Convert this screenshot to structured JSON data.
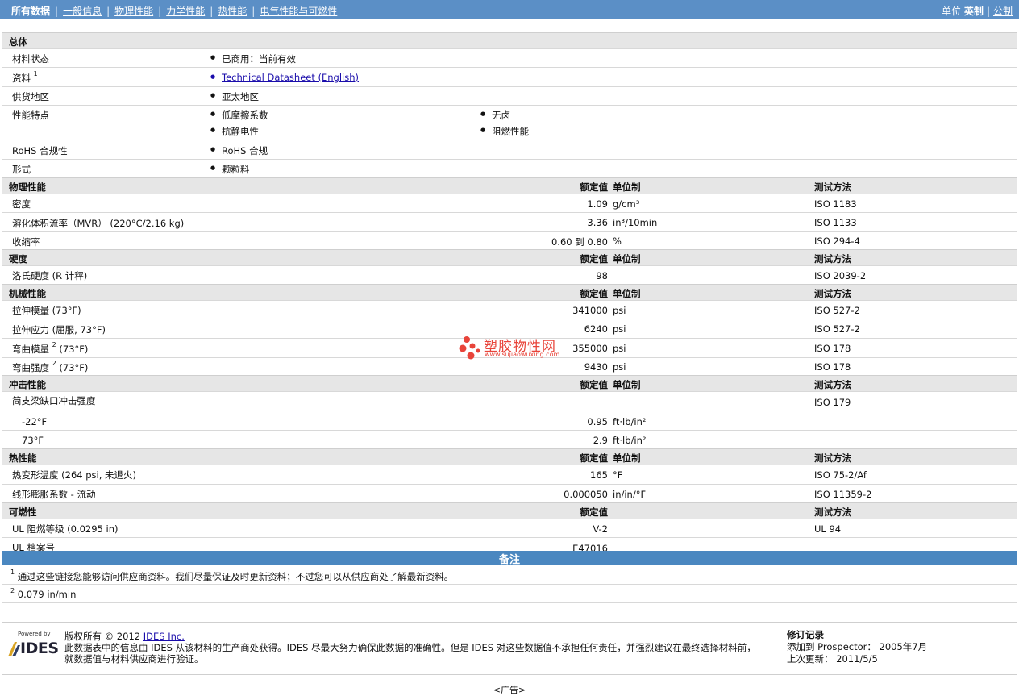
{
  "topnav": {
    "items": [
      {
        "label": "所有数据",
        "current": true
      },
      {
        "label": "一般信息"
      },
      {
        "label": "物理性能"
      },
      {
        "label": "力学性能"
      },
      {
        "label": "热性能"
      },
      {
        "label": "电气性能与可燃性"
      }
    ],
    "units_label": "单位",
    "unit_english": "英制",
    "unit_metric": "公制"
  },
  "general": {
    "title": "总体",
    "material_status_label": "材料状态",
    "material_status": "已商用：当前有效",
    "documents_label": "资料",
    "documents_sup": "1",
    "documents_link": "Technical Datasheet (English)",
    "region_label": "供货地区",
    "region": "亚太地区",
    "features_label": "性能特点",
    "features": [
      "低摩擦系数",
      "无卤",
      "抗静电性",
      "阻燃性能"
    ],
    "rohs_label": "RoHS 合规性",
    "rohs": "RoHS 合规",
    "form_label": "形式",
    "form": "颗粒料"
  },
  "headers": {
    "nominal": "额定值",
    "unit": "单位制",
    "test": "测试方法"
  },
  "physical": {
    "title": "物理性能",
    "rows": [
      {
        "name": "密度",
        "value": "1.09",
        "unit": "g/cm³",
        "test": "ISO 1183"
      },
      {
        "name": "溶化体积流率（MVR） (220°C/2.16 kg)",
        "value": "3.36",
        "unit": "in³/10min",
        "test": "ISO 1133"
      },
      {
        "name": "收缩率",
        "value": "0.60 到  0.80",
        "unit": "%",
        "test": "ISO 294-4"
      }
    ]
  },
  "hardness": {
    "title": "硬度",
    "rows": [
      {
        "name": "洛氏硬度 (R 计秤)",
        "value": "98",
        "unit": "",
        "test": "ISO 2039-2"
      }
    ]
  },
  "mechanical": {
    "title": "机械性能",
    "rows": [
      {
        "name": "拉伸模量 (73°F)",
        "sup": "",
        "value": "341000",
        "unit": "psi",
        "test": "ISO 527-2"
      },
      {
        "name": "拉伸应力 (屈服, 73°F)",
        "sup": "",
        "value": "6240",
        "unit": "psi",
        "test": "ISO 527-2"
      },
      {
        "name": "弯曲模量",
        "sup": "2",
        "tail": " (73°F)",
        "value": "355000",
        "unit": "psi",
        "test": "ISO 178"
      },
      {
        "name": "弯曲强度",
        "sup": "2",
        "tail": " (73°F)",
        "value": "9430",
        "unit": "psi",
        "test": "ISO 178"
      }
    ]
  },
  "impact": {
    "title": "冲击性能",
    "rows": [
      {
        "name": "简支梁缺口冲击强度",
        "value": "",
        "unit": "",
        "test": "ISO 179"
      },
      {
        "name": "-22°F",
        "value": "0.95",
        "unit": "ft·lb/in²",
        "test": ""
      },
      {
        "name": "73°F",
        "value": "2.9",
        "unit": "ft·lb/in²",
        "test": ""
      }
    ]
  },
  "thermal": {
    "title": "热性能",
    "rows": [
      {
        "name": "热变形温度 (264 psi, 未退火)",
        "value": "165",
        "unit": "°F",
        "test": "ISO 75-2/Af"
      },
      {
        "name": "线形膨胀系数 - 流动",
        "value": "0.000050",
        "unit": "in/in/°F",
        "test": "ISO 11359-2"
      }
    ]
  },
  "flammability": {
    "title": "可燃性",
    "rows": [
      {
        "name": "UL 阻燃等级 (0.0295 in)",
        "value": "V-2",
        "unit": "",
        "test": "UL 94"
      },
      {
        "name": "UL 档案号",
        "value": "E47016",
        "unit": "",
        "test": ""
      }
    ]
  },
  "notes": {
    "title": "备注",
    "items": [
      {
        "sup": "1",
        "text": "通过这些链接您能够访问供应商资料。我们尽量保证及时更新资料；不过您可以从供应商处了解最新资料。"
      },
      {
        "sup": "2",
        "text": "0.079 in/min"
      }
    ]
  },
  "footer": {
    "logo_powered": "Powered by",
    "logo_name": "IDES",
    "copyright_prefix": "版权所有  © 2012 ",
    "copyright_link": "IDES Inc.",
    "disclaimer_1": "此数据表中的信息由 IDES 从该材料的生产商处获得。IDES 尽最大努力确保此数据的准确性。但是 IDES 对这些数据值不承担任何责任，并强烈建议在最终选择材料前，",
    "disclaimer_2": "就数据值与材料供应商进行验证。",
    "rev_title": "修订记录",
    "added_label": "添加到 Prospector：",
    "added_value": "2005年7月",
    "updated_label": "上次更新：",
    "updated_value": "2011/5/5"
  },
  "ad_label": "<广告>",
  "watermark": {
    "title": "塑胶物性网",
    "url": "www.sujiaowuxing.com"
  },
  "colors": {
    "topbar": "#5b8fc6",
    "section": "#e6e6e6",
    "notes_bar": "#4a87c0",
    "link": "#1a0dab",
    "watermark": "#e8443a"
  }
}
